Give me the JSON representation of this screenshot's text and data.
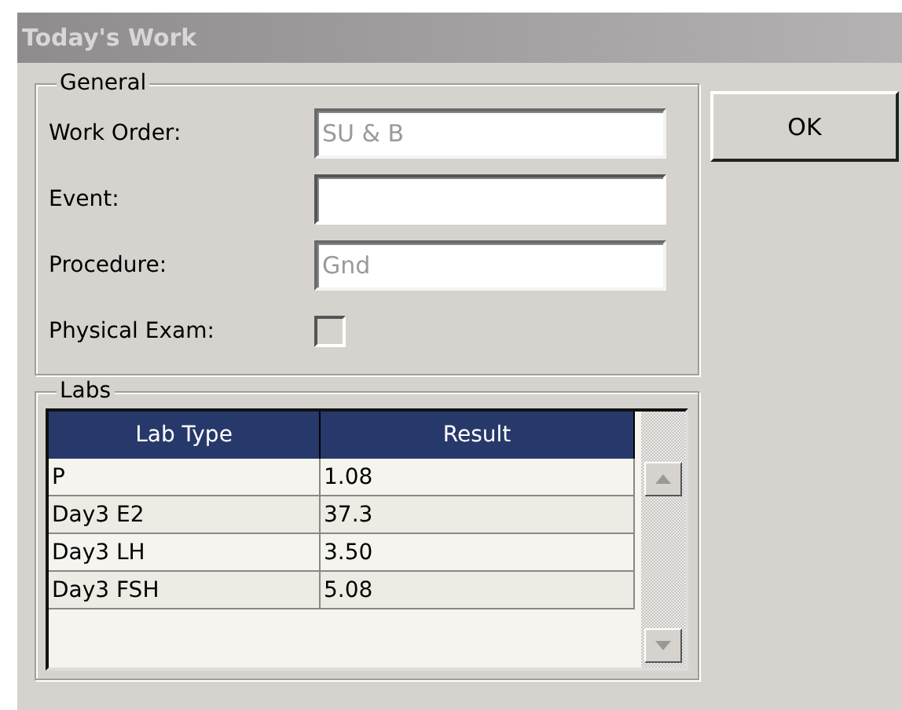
{
  "window": {
    "title": "Today's Work"
  },
  "general": {
    "legend": "General",
    "fields": [
      {
        "kind": "text",
        "label": "Work Order:",
        "value": "SU & B",
        "disabled": true
      },
      {
        "kind": "text",
        "label": "Event:",
        "disabled": false
      },
      {
        "kind": "text",
        "label": "Procedure:",
        "value": "Gnd",
        "disabled": true
      },
      {
        "kind": "checkbox",
        "label": "Physical Exam:",
        "checked": false
      }
    ]
  },
  "buttons": [
    "OK"
  ],
  "labs": {
    "legend": "Labs",
    "columns": [
      "Lab Type",
      "Result"
    ],
    "rows": [
      [
        "P",
        "1.08"
      ],
      [
        "Day3 E2",
        "37.3"
      ],
      [
        "Day3 LH",
        "3.50"
      ],
      [
        "Day3 FSH",
        "5.08"
      ]
    ]
  }
}
